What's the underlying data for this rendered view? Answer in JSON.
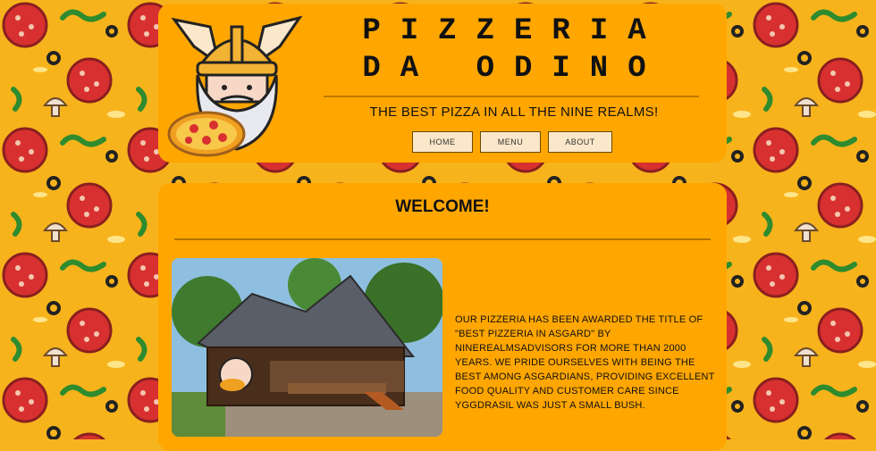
{
  "header": {
    "title": "PIZZERIA DA ODINO",
    "tagline": "THE BEST PIZZA IN ALL THE NINE REALMS!"
  },
  "nav": {
    "home_label": "HOME",
    "menu_label": "MENU",
    "about_label": "ABOUT"
  },
  "main": {
    "heading": "WELCOME!",
    "about_text": "OUR PIZZERIA HAS BEEN AWARDED THE TITLE OF \"BEST PIZZERIA IN ASGARD\" BY NINEREALMSADVISORS FOR MORE THAN 2000 YEARS. WE PRIDE OURSELVES WITH BEING THE BEST AMONG ASGARDIANS, PROVIDING EXCELLENT FOOD QUALITY AND CUSTOMER CARE SINCE YGGDRASIL WAS JUST A SMALL BUSH."
  },
  "colors": {
    "panel": "#ffa600",
    "background": "#f6b51e",
    "button": "#fbe7c9"
  },
  "icons": {
    "logo": "odin-viking-pizza-logo",
    "background": "pepperoni-pizza-pattern"
  }
}
